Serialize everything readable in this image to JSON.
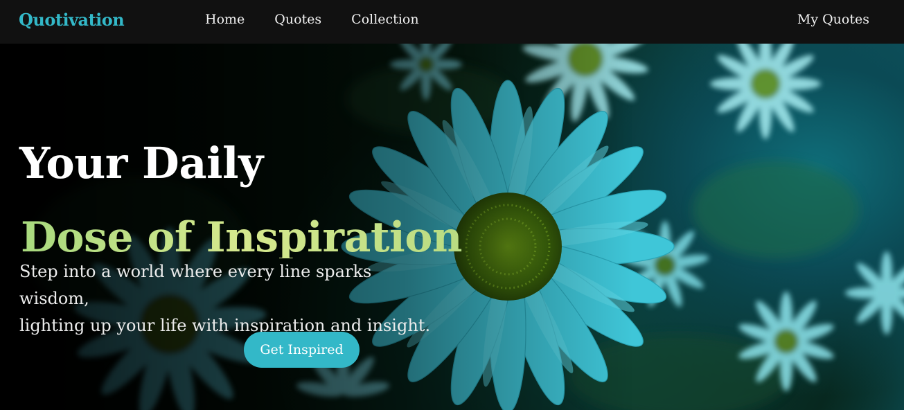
{
  "nav": {
    "brand": "Quotivation",
    "links": [
      "Home",
      "Quotes",
      "Collection"
    ],
    "right_link": "My Quotes"
  },
  "hero": {
    "title_line1": "Your Daily",
    "title_line2": "Dose of Inspiration",
    "tagline_line1": "Step into a world where every line sparks wisdom,",
    "tagline_line2": "lighting up your life with inspiration and insight.",
    "cta_label": "Get Inspired"
  },
  "colors": {
    "accent": "#33b8c8",
    "navbar_bg": "#111111",
    "title_gradient_start": "#a8d97e",
    "title_gradient_end": "#d6e98e"
  },
  "background_image": "daisy-flowers"
}
